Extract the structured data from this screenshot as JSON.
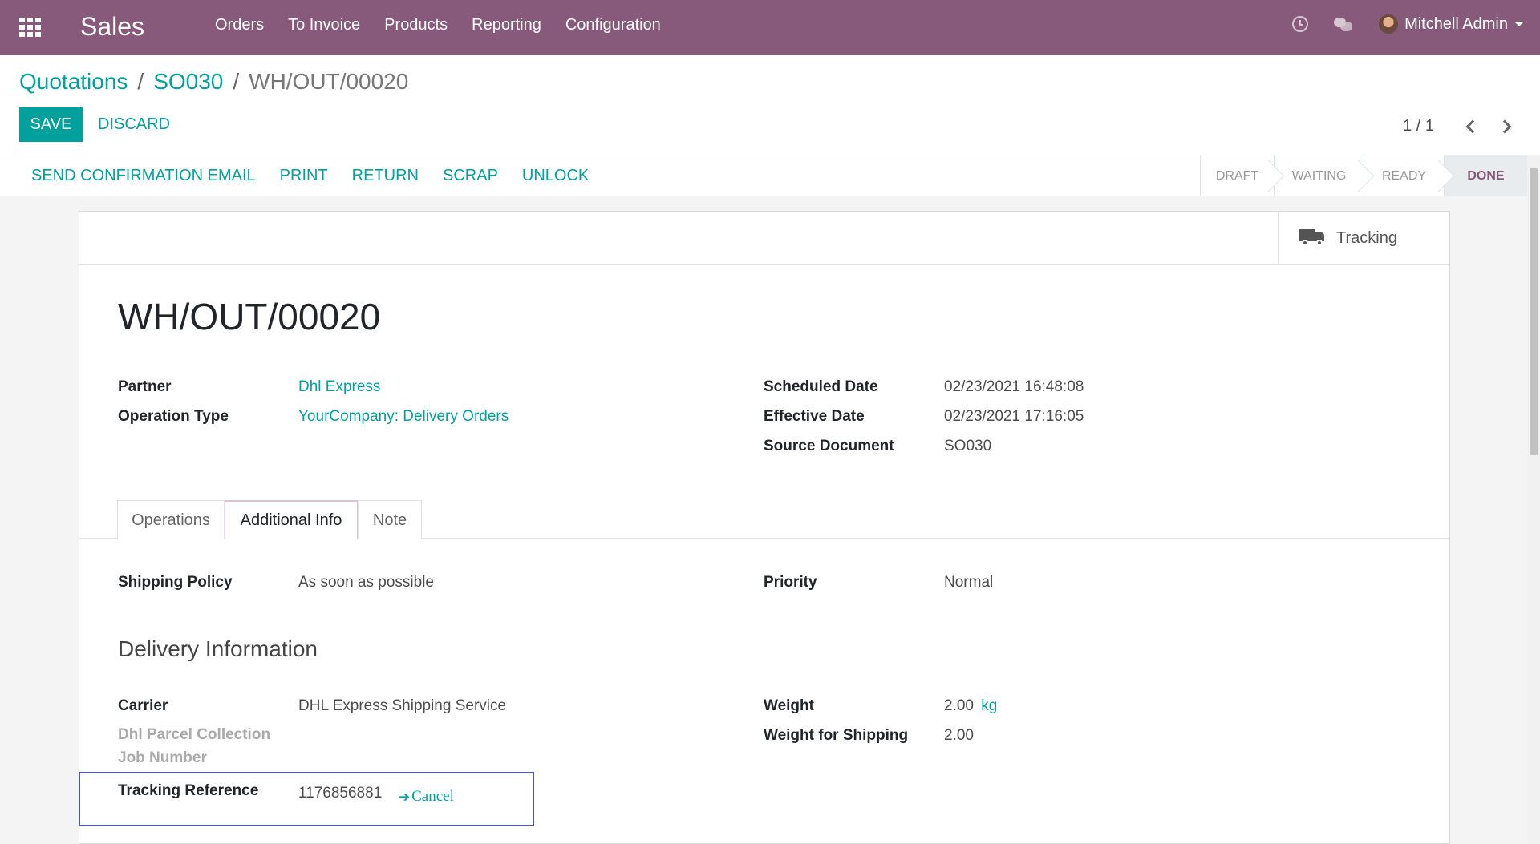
{
  "navbar": {
    "app_name": "Sales",
    "menu": [
      "Orders",
      "To Invoice",
      "Products",
      "Reporting",
      "Configuration"
    ],
    "user_name": "Mitchell Admin",
    "icons": [
      "apps-grid-icon",
      "clock-icon",
      "chat-icon",
      "avatar",
      "caret-down-icon"
    ]
  },
  "breadcrumb": {
    "items": [
      "Quotations",
      "SO030"
    ],
    "current": "WH/OUT/00020",
    "separator": "/"
  },
  "buttons": {
    "save": "SAVE",
    "discard": "DISCARD"
  },
  "pager": {
    "value": "1 / 1"
  },
  "status_actions": [
    "SEND CONFIRMATION EMAIL",
    "PRINT",
    "RETURN",
    "SCRAP",
    "UNLOCK"
  ],
  "stages": {
    "items": [
      "DRAFT",
      "WAITING",
      "READY",
      "DONE"
    ],
    "current": "DONE"
  },
  "smart_button": {
    "label": "Tracking",
    "icon": "truck-icon"
  },
  "record": {
    "title": "WH/OUT/00020",
    "partner_label": "Partner",
    "partner": "Dhl Express",
    "operation_type_label": "Operation Type",
    "operation_type": "YourCompany: Delivery Orders",
    "scheduled_date_label": "Scheduled Date",
    "scheduled_date": "02/23/2021 16:48:08",
    "effective_date_label": "Effective Date",
    "effective_date": "02/23/2021 17:16:05",
    "source_document_label": "Source Document",
    "source_document": "SO030"
  },
  "tabs": {
    "items": [
      "Operations",
      "Additional Info",
      "Note"
    ],
    "active": "Additional Info"
  },
  "additional_info": {
    "shipping_policy_label": "Shipping Policy",
    "shipping_policy": "As soon as possible",
    "priority_label": "Priority",
    "priority": "Normal",
    "section_title": "Delivery Information",
    "carrier_label": "Carrier",
    "carrier": "DHL Express Shipping Service",
    "dhl_parcel_label_line1": "Dhl Parcel Collection",
    "dhl_parcel_label_line2": "Job Number",
    "tracking_reference_label": "Tracking Reference",
    "tracking_reference": "1176856881",
    "cancel_label": "Cancel",
    "weight_label": "Weight",
    "weight": "2.00",
    "weight_unit": "kg",
    "weight_shipping_label": "Weight for Shipping",
    "weight_shipping": "2.00"
  },
  "colors": {
    "navbar": "#875a7b",
    "accent": "#00a09d",
    "highlight_box": "#5050d0"
  }
}
